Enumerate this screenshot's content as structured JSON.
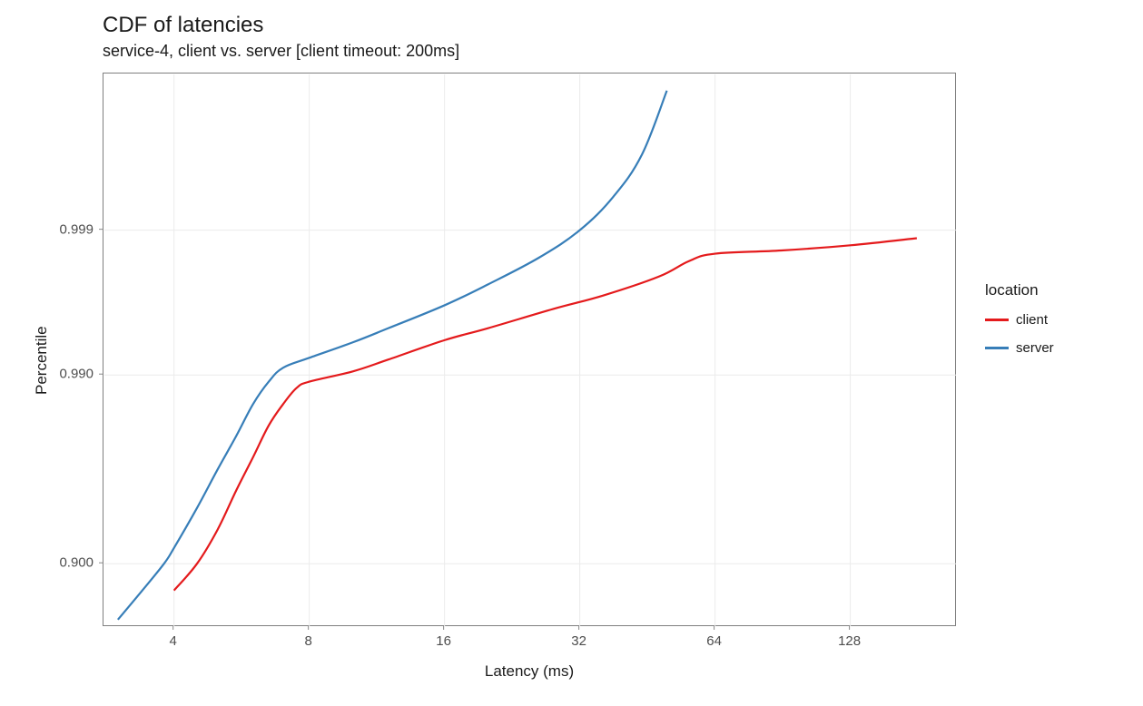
{
  "chart_data": {
    "type": "line",
    "title": "CDF of latencies",
    "subtitle": "service-4, client vs. server [client timeout: 200ms]",
    "xlabel": "Latency (ms)",
    "ylabel": "Percentile",
    "x_scale": "log2",
    "y_scale": "probit_like",
    "x_ticks": [
      4,
      8,
      16,
      32,
      64,
      128
    ],
    "y_ticks": [
      0.9,
      0.99,
      0.999
    ],
    "x_range": [
      2.8,
      220
    ],
    "y_range": [
      0.82,
      0.99995
    ],
    "legend_title": "location",
    "series": [
      {
        "name": "client",
        "color": "#e41a1c",
        "points": [
          {
            "x": 4.0,
            "y": 0.87
          },
          {
            "x": 4.5,
            "y": 0.9
          },
          {
            "x": 5.0,
            "y": 0.93
          },
          {
            "x": 5.5,
            "y": 0.955
          },
          {
            "x": 6.0,
            "y": 0.97
          },
          {
            "x": 6.5,
            "y": 0.98
          },
          {
            "x": 7.0,
            "y": 0.985
          },
          {
            "x": 7.5,
            "y": 0.988
          },
          {
            "x": 8.0,
            "y": 0.989
          },
          {
            "x": 10.0,
            "y": 0.9905
          },
          {
            "x": 12.0,
            "y": 0.992
          },
          {
            "x": 16.0,
            "y": 0.994
          },
          {
            "x": 20.0,
            "y": 0.995
          },
          {
            "x": 28.0,
            "y": 0.9963
          },
          {
            "x": 36.0,
            "y": 0.997
          },
          {
            "x": 48.0,
            "y": 0.9978
          },
          {
            "x": 56.0,
            "y": 0.9983
          },
          {
            "x": 64.0,
            "y": 0.9985
          },
          {
            "x": 90.0,
            "y": 0.99858
          },
          {
            "x": 128.0,
            "y": 0.9987
          },
          {
            "x": 180.0,
            "y": 0.99885
          }
        ]
      },
      {
        "name": "server",
        "color": "#377eb8",
        "points": [
          {
            "x": 3.0,
            "y": 0.83
          },
          {
            "x": 3.4,
            "y": 0.87
          },
          {
            "x": 3.8,
            "y": 0.9
          },
          {
            "x": 4.0,
            "y": 0.915
          },
          {
            "x": 4.5,
            "y": 0.945
          },
          {
            "x": 5.0,
            "y": 0.965
          },
          {
            "x": 5.5,
            "y": 0.977
          },
          {
            "x": 6.0,
            "y": 0.985
          },
          {
            "x": 6.5,
            "y": 0.989
          },
          {
            "x": 7.0,
            "y": 0.991
          },
          {
            "x": 8.0,
            "y": 0.9922
          },
          {
            "x": 10.0,
            "y": 0.9938
          },
          {
            "x": 12.0,
            "y": 0.995
          },
          {
            "x": 16.0,
            "y": 0.9965
          },
          {
            "x": 20.0,
            "y": 0.9975
          },
          {
            "x": 26.0,
            "y": 0.9984
          },
          {
            "x": 32.0,
            "y": 0.999
          },
          {
            "x": 38.0,
            "y": 0.99945
          },
          {
            "x": 44.0,
            "y": 0.99975
          },
          {
            "x": 50.0,
            "y": 0.99993
          }
        ]
      }
    ]
  }
}
